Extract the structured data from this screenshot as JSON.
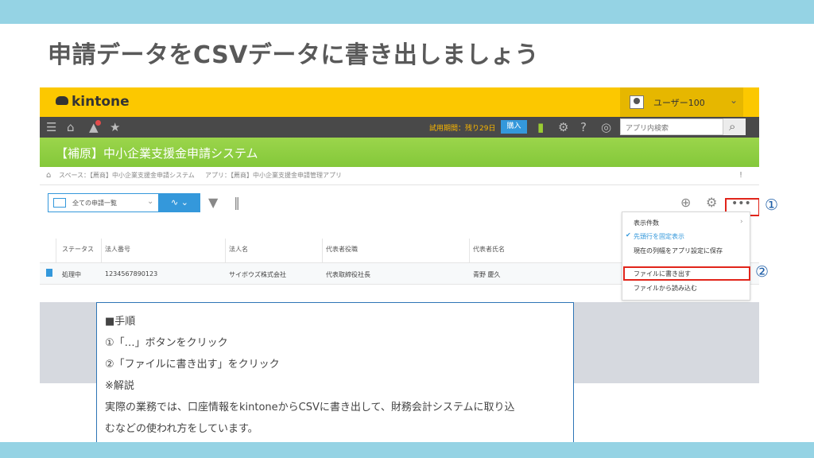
{
  "slide": {
    "title": "申請データをCSVデータに書き出しましょう"
  },
  "app": {
    "logo": "kintone",
    "user_name": "ユーザー100",
    "trial_text": "試用期間：残り29日",
    "buy_label": "購入",
    "search_placeholder": "アプリ内検索",
    "app_title": "【補原】中小企業支援金申請システム",
    "breadcrumb": {
      "space": "スペース：【薦商】中小企業支援金申請システム",
      "app": "アプリ：【薦商】中小企業支援金申請管理アプリ"
    },
    "view_select": "全ての申請一覧",
    "table": {
      "headers": [
        "ステータス",
        "法人番号",
        "法人名",
        "代表者役職",
        "代表者氏名"
      ],
      "rows": [
        [
          "処理中",
          "1234567890123",
          "サイボウズ株式会社",
          "代表取締役社長",
          "青野 慶久"
        ]
      ]
    },
    "menu": {
      "items": [
        {
          "label": "表示件数"
        },
        {
          "label": "先頭行を固定表示",
          "checked": true
        },
        {
          "label": "現在の列幅をアプリ設定に保存"
        },
        {
          "label": "ファイルに書き出す",
          "highlighted": true
        },
        {
          "label": "ファイルから読み込む"
        }
      ]
    }
  },
  "callouts": {
    "one": "①",
    "two": "②"
  },
  "note": {
    "lines": [
      "■手順",
      "①「…」ボタンをクリック",
      "②「ファイルに書き出す」をクリック",
      "※解説",
      "実際の業務では、口座情報をkintoneからCSVに書き出して、財務会計システムに取り込",
      "むなどの使われ方をしています。"
    ]
  }
}
